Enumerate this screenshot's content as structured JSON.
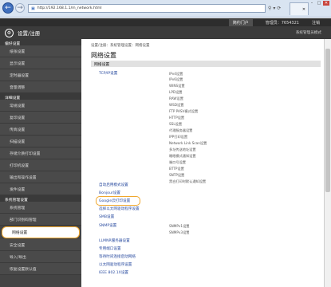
{
  "browser": {
    "url": "http://192.168.1.1/m_network.html",
    "tab_label": "",
    "tabstrip_hint": [
      "Tonico",
      "Lorem",
      "Lorem"
    ]
  },
  "topbar": {
    "lang_label": "简约门户",
    "user_label": "管理员：7654321",
    "logout_label": "注销"
  },
  "header": {
    "title": "设置/注册",
    "right_text": "系统管理员模式"
  },
  "sidebar": {
    "sections": [
      {
        "title": "偏好设置",
        "items": [
          "纸张设置",
          "显示设置",
          "定时器设置",
          "音量调整"
        ]
      },
      {
        "title": "详细设置",
        "items": [
          "常规设置",
          "复印设置",
          "传真设置",
          "扫描设置",
          "存储介质打印设置",
          "打印机设置",
          "输出和操作设置",
          "发件设置"
        ]
      },
      {
        "title": "系统管理设置",
        "items": [
          "系统管理",
          "部门识别码管理",
          "网络设置",
          "安全设置",
          "导入/导出",
          "恢复设置默认值"
        ]
      }
    ]
  },
  "main": {
    "breadcrumb": "设置/注册：系统管理设置：网络设置",
    "title": "网络设置",
    "section": "网络设置",
    "tcpip": "TCP/IP设置",
    "tcpip_subs": [
      "IPv4设置",
      "IPv6设置",
      "WINS设置",
      "LPD设置",
      "RAW设置",
      "WSD设置",
      "FTP PASV模式设置",
      "HTTP设置",
      "SSL设置",
      "代理服务器设置",
      "IPP打印设置",
      "Network Link Scan设置",
      "多址传送地址设置",
      "睡眠模式通知设置",
      "端口号设置",
      "BTTP设置",
      "SNTP设置",
      "黑白打印时默认通知设置"
    ],
    "links": [
      "自动启用模式设置",
      "Bonjour设置",
      "Google云打印设置",
      "选择以太网驱动程序设置",
      "SMB设置"
    ],
    "snmp": "SNMP设置",
    "snmp_subs": [
      "SNMPv1设置",
      "SNMPv3设置"
    ],
    "links2": [
      "LLMNR服务器设置",
      "专用端口设置",
      "等待时间连接启动网络",
      "以太网驱动程序设置",
      "IEEE 802.1X设置"
    ]
  }
}
